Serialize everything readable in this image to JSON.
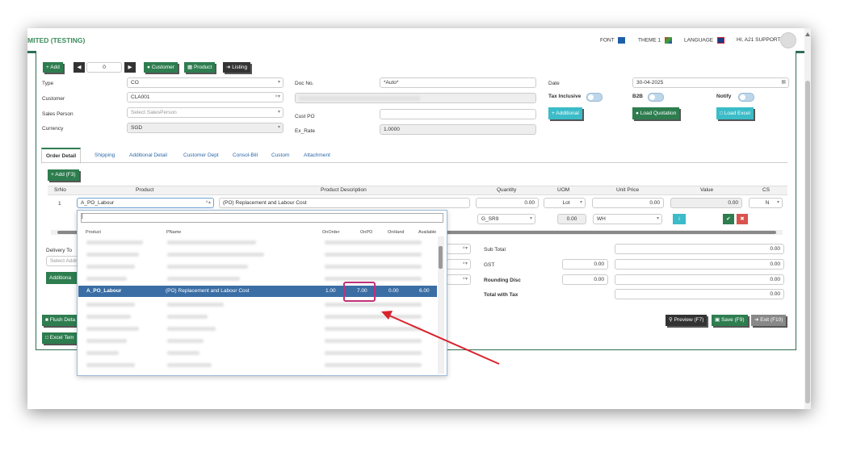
{
  "topbar": {
    "company": "MITED (TESTING)",
    "font_label": "FONT",
    "theme_label": "THEME 1",
    "language_label": "LANGUAGE",
    "user_label": "HI, A21 SUPPORT"
  },
  "toolbar": {
    "add_label": "+ Add",
    "record_index": "0",
    "customer_label": "Customer",
    "product_label": "Product",
    "listing_label": "Listing"
  },
  "form": {
    "type_label": "Type",
    "type_value": "CO",
    "customer_label": "Customer",
    "customer_value": "CLA001",
    "sales_person_label": "Sales Person",
    "sales_person_placeholder": "Select SalesPerson",
    "currency_label": "Currency",
    "currency_value": "SGD",
    "doc_no_label": "Doc No.",
    "doc_no_value": "*Auto*",
    "cust_po_label": "Cust PO",
    "ex_rate_label": "Ex_Rate",
    "ex_rate_value": "1.0000",
    "date_label": "Date",
    "date_value": "30-04-2025",
    "tax_inclusive_label": "Tax Inclusive",
    "b2b_label": "B2B",
    "notify_label": "Notify",
    "additional_label": "+ Additional",
    "load_quotation_label": "Load Quotation",
    "load_excel_label": "Load Excel"
  },
  "tabs": [
    "Order Detail",
    "Shipping",
    "Additional Detail",
    "Customer Dept",
    "Consol-Bill",
    "Custom",
    "Attachment"
  ],
  "grid": {
    "add_label": "+ Add (F3)",
    "headers": {
      "srno": "SrNo",
      "product": "Product",
      "description": "Product Description",
      "quantity": "Quantity",
      "uom": "UOM",
      "unit_price": "Unit Price",
      "value": "Value",
      "cs": "CS"
    },
    "row": {
      "srno": "1",
      "product": "A_PO_Labour",
      "description": "(PO) Replacement and Labour Cost",
      "quantity": "0.00",
      "uom": "Lot",
      "unit_price": "0.00",
      "value": "0.00",
      "cs": "N",
      "tax_code": "G_SR9",
      "tax_amount": "0.00",
      "location": "WH"
    }
  },
  "bottom_left": {
    "delivery_to_label": "Delivery To",
    "select_placeholder": "Select Addr",
    "additional_label": "Additiona",
    "flush_label": "Flush Deta",
    "excel_label": "Excel Tem"
  },
  "totals": {
    "sub_total_label": "Sub Total",
    "sub_total_value": "0.00",
    "gst_label": "GST",
    "gst_rate": "0.00",
    "gst_value": "0.00",
    "rounding_label": "Rounding Disc",
    "rounding_rate": "0.00",
    "rounding_value": "0.00",
    "total_tax_label": "Total with Tax",
    "total_tax_value": "0.00"
  },
  "actions": {
    "preview_label": "Preview (F7)",
    "save_label": "Save (F9)",
    "exit_label": "Exit (F10)"
  },
  "dropdown": {
    "search_value": "|",
    "headers": {
      "product": "Product",
      "pname": "PName",
      "onorder": "OnOrder",
      "onpo": "OnPO",
      "onhand": "OnHand",
      "available": "Available"
    },
    "selected": {
      "product": "A_PO_Labour",
      "pname": "(PO) Replacement and Labour Cost",
      "onorder": "1.00",
      "onpo": "7.00",
      "onhand": "0.00",
      "available": "6.00"
    }
  },
  "colors": {
    "brand_green": "#2e7d4f",
    "teal": "#3bbcc8",
    "highlight": "#c0337a",
    "arrow": "#d9232d",
    "selected_row": "#3a6ea5"
  }
}
